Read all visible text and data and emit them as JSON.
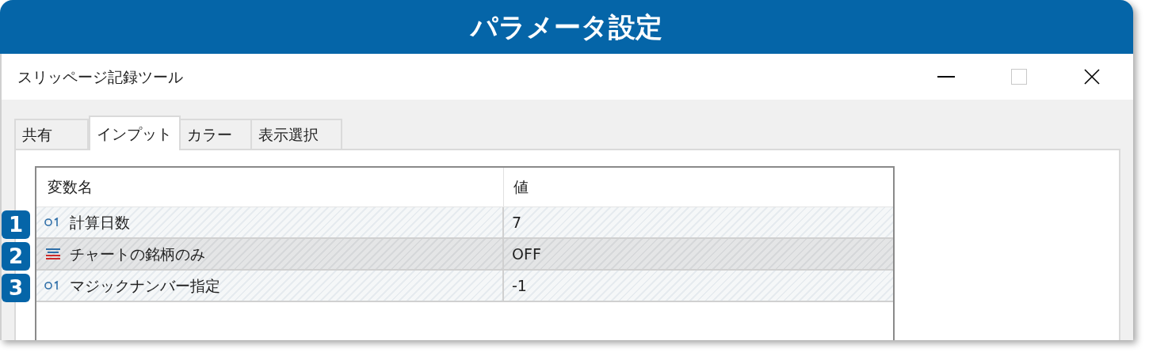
{
  "banner": {
    "title": "パラメータ設定"
  },
  "window": {
    "title": "スリッページ記録ツール"
  },
  "tabs": [
    {
      "label": "共有",
      "selected": false
    },
    {
      "label": "インプット",
      "selected": true
    },
    {
      "label": "カラー",
      "selected": false
    },
    {
      "label": "表示選択",
      "selected": false
    }
  ],
  "table": {
    "columns": [
      "変数名",
      "値"
    ],
    "rows": [
      {
        "badge": "1",
        "kind": "int",
        "name": "計算日数",
        "value": "7",
        "selected": false
      },
      {
        "badge": "2",
        "kind": "bool",
        "name": "チャートの銘柄のみ",
        "value": "OFF",
        "selected": true
      },
      {
        "badge": "3",
        "kind": "int",
        "name": "マジックナンバー指定",
        "value": "-1",
        "selected": false
      }
    ]
  }
}
